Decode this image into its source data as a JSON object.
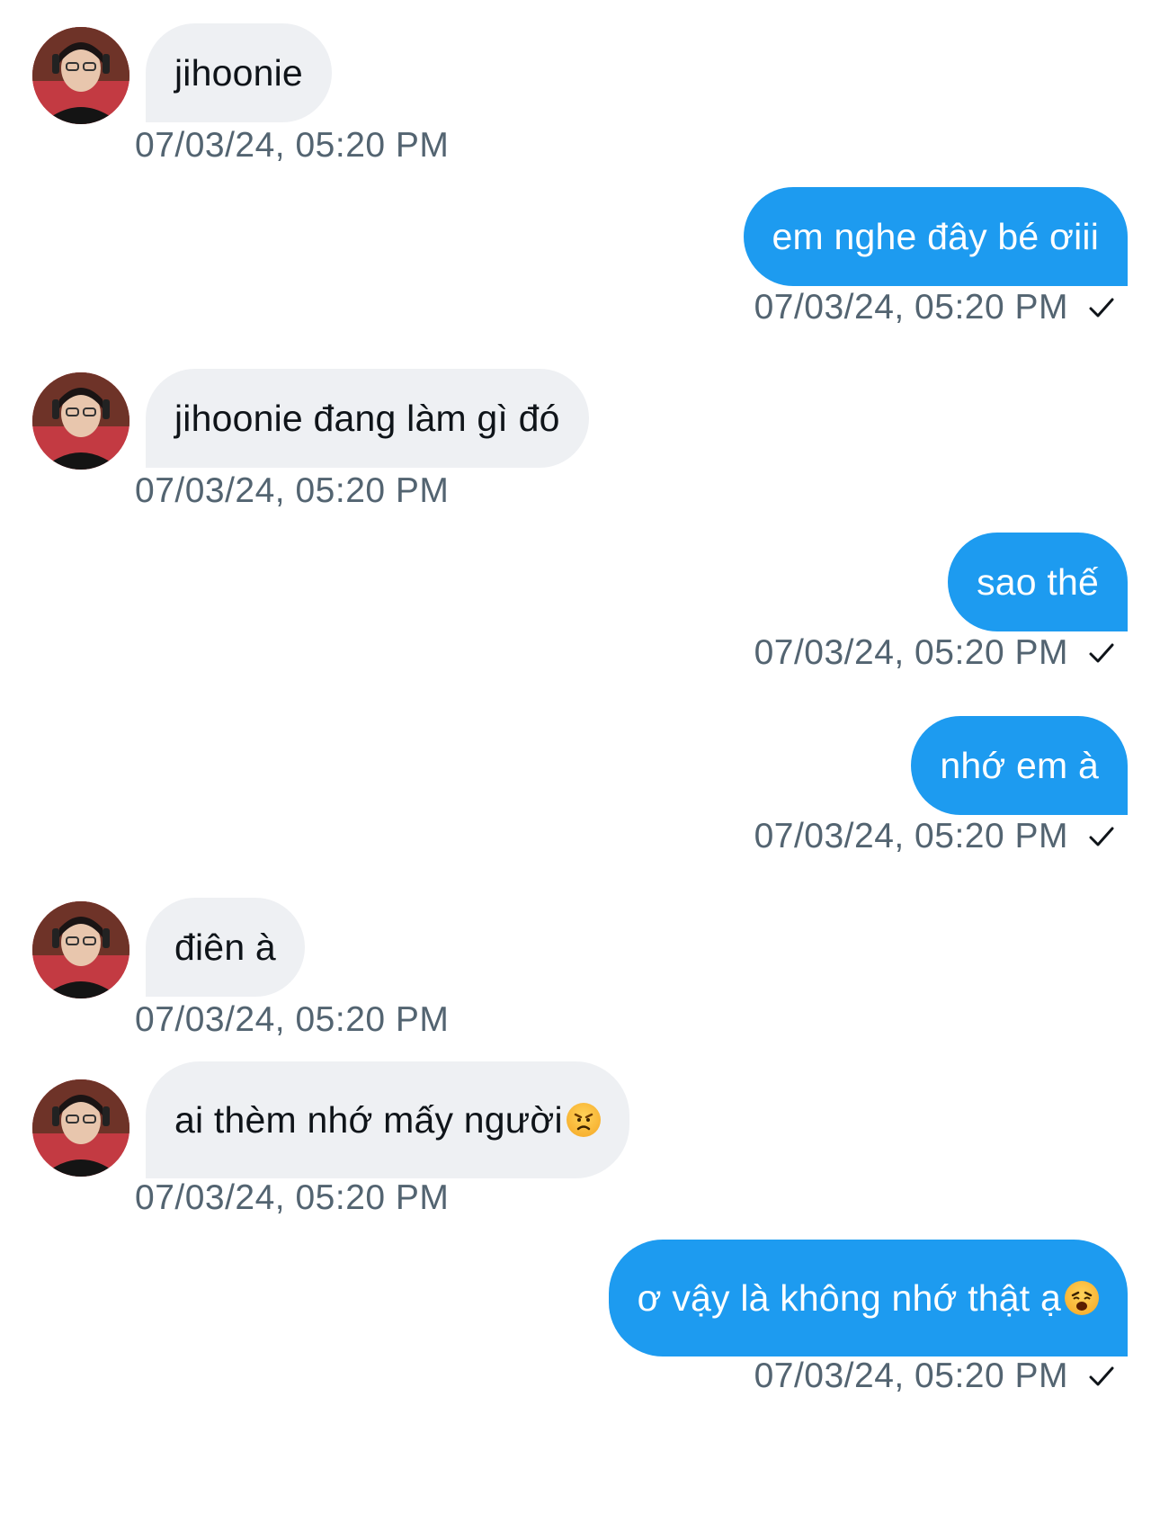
{
  "messages": [
    {
      "dir": "in",
      "text": "jihoonie",
      "time": "07/03/24, 05:20 PM"
    },
    {
      "dir": "out",
      "text": "em nghe đây bé ơiii",
      "time": "07/03/24, 05:20 PM",
      "status_icon": "check-icon"
    },
    {
      "dir": "in",
      "text": "jihoonie đang làm gì đó",
      "time": "07/03/24, 05:20 PM"
    },
    {
      "dir": "out",
      "text": "sao thế",
      "time": "07/03/24, 05:20 PM",
      "status_icon": "check-icon"
    },
    {
      "dir": "out",
      "text": "nhớ em à",
      "time": "07/03/24, 05:20 PM",
      "status_icon": "check-icon"
    },
    {
      "dir": "in",
      "text": "điên à",
      "time": "07/03/24, 05:20 PM"
    },
    {
      "dir": "in",
      "text": "ai thèm nhớ mấy người",
      "emoji": "angry-face-emoji",
      "time": "07/03/24, 05:20 PM"
    },
    {
      "dir": "out",
      "text": "ơ vậy là không nhớ thật ạ",
      "emoji": "weary-face-emoji",
      "time": "07/03/24, 05:20 PM",
      "status_icon": "check-icon"
    }
  ],
  "colors": {
    "outgoing_bubble": "#1d9bf0",
    "incoming_bubble": "#eef0f3",
    "timestamp": "#536471"
  },
  "avatar_icon": "user-avatar"
}
